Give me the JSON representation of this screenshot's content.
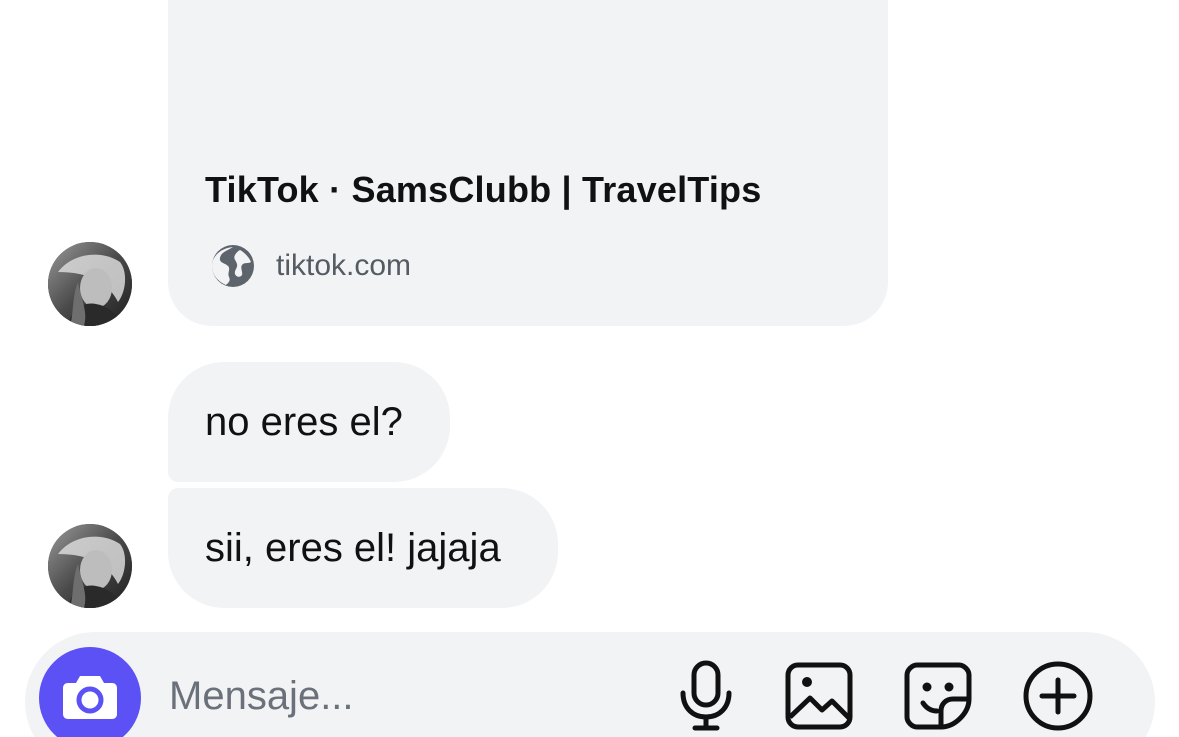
{
  "link_preview": {
    "title": "TikTok · SamsClubb | TravelTips",
    "domain": "tiktok.com",
    "icon": "globe-icon"
  },
  "messages": [
    {
      "text": "no eres el?"
    },
    {
      "text": "sii, eres el! jajaja"
    }
  ],
  "composer": {
    "placeholder": "Mensaje...",
    "camera_icon": "camera-icon",
    "tools": [
      "microphone-icon",
      "gallery-icon",
      "sticker-icon",
      "plus-circle-icon"
    ]
  },
  "colors": {
    "bubble_background": "#f2f3f5",
    "camera_button": "#5b51f4",
    "text": "#111111",
    "secondary_text": "#555b63"
  }
}
